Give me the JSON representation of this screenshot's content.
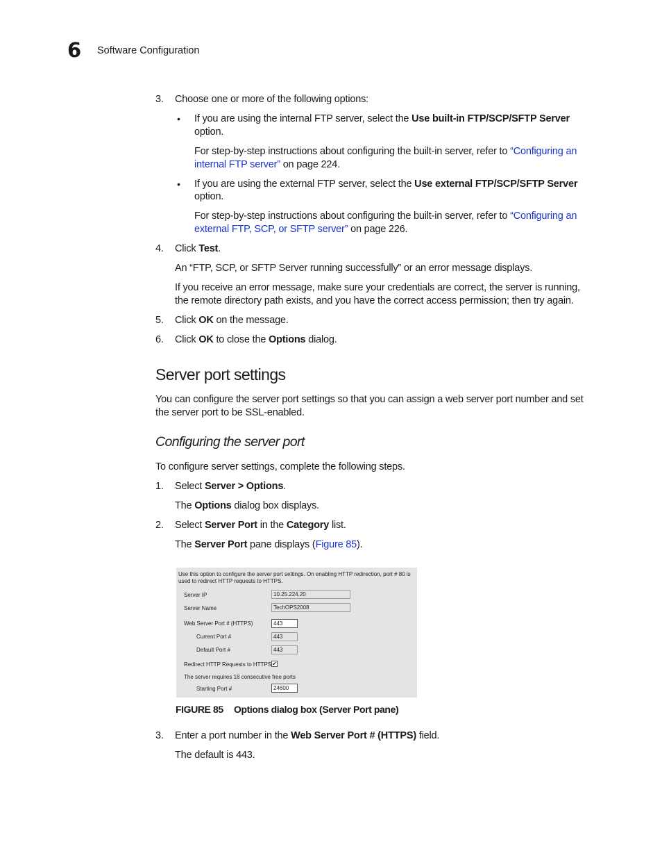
{
  "header": {
    "chapter_number": "6",
    "chapter_title": "Software Configuration"
  },
  "section1": {
    "step3": {
      "number": "3.",
      "text": "Choose one or more of the following options:",
      "bullets": [
        {
          "symbol": "•",
          "pre": "If you are using the internal FTP server, select the ",
          "bold": "Use built-in FTP/SCP/SFTP Server",
          "post_line2": "option.",
          "ref_pre": "For step-by-step instructions about configuring the built-in server, refer to ",
          "ref_link_line1": "“Configuring an",
          "ref_link_line2": "internal FTP server”",
          "ref_post": " on page 224."
        },
        {
          "symbol": "•",
          "pre": "If you are using the external FTP server, select the ",
          "bold": "Use external FTP/SCP/SFTP Server",
          "post_line2": "option.",
          "ref_pre": "For step-by-step instructions about configuring the built-in server, refer to ",
          "ref_link_line1": "“Configuring an",
          "ref_link_line2": "external FTP, SCP, or SFTP server”",
          "ref_post": " on page 226."
        }
      ]
    },
    "step4": {
      "number": "4.",
      "pre": "Click ",
      "bold": "Test",
      "post": ".",
      "result": "An “FTP, SCP, or SFTP Server running successfully” or an error message displays.",
      "note_line1": "If you receive an error message, make sure your credentials are correct, the server is running,",
      "note_line2": "the remote directory path exists, and you have the correct access permission; then try again."
    },
    "step5": {
      "number": "5.",
      "pre": "Click ",
      "bold": "OK",
      "post": " on the message."
    },
    "step6": {
      "number": "6.",
      "pre": "Click ",
      "bold": "OK",
      "mid": " to close the ",
      "bold2": "Options",
      "post": " dialog."
    }
  },
  "section2": {
    "heading": "Server port settings",
    "intro_line1": "You can configure the server port settings so that you can assign a web server port number and set",
    "intro_line2": "the server port to be SSL-enabled.",
    "subheading": "Configuring the server port",
    "lead": "To configure server settings, complete the following steps.",
    "step1": {
      "number": "1.",
      "pre": "Select ",
      "bold": "Server > Options",
      "post": ".",
      "result_pre": "The ",
      "result_bold": "Options",
      "result_post": " dialog box displays."
    },
    "step2": {
      "number": "2.",
      "pre": "Select ",
      "bold": "Server Port",
      "mid": " in the ",
      "bold2": "Category",
      "post": " list.",
      "result_pre": "The ",
      "result_bold": "Server Port",
      "result_mid": " pane displays (",
      "result_link": "Figure 85",
      "result_post": ")."
    },
    "step3": {
      "number": "3.",
      "pre": "Enter a port number in the ",
      "bold": "Web Server Port # (HTTPS)",
      "post": " field.",
      "result": "The default is 443."
    }
  },
  "figure": {
    "description_line1": "Use this option to configure the server port settings. On enabling HTTP redirection, port # 80 is",
    "description_line2": "used to redirect HTTP requests to HTTPS.",
    "server_ip_label": "Server IP",
    "server_ip_value": "10.25.224.20",
    "server_name_label": "Server Name",
    "server_name_value": "TechOPS2008",
    "web_port_label": "Web Server Port # (HTTPS)",
    "web_port_value": "443",
    "current_port_label": "Current Port #",
    "current_port_value": "443",
    "default_port_label": "Default Port #",
    "default_port_value": "443",
    "redirect_label": "Redirect HTTP Requests to HTTPS",
    "redirect_checked": true,
    "redirect_check_glyph": "✔",
    "free_ports_note": "The server requires 18 consecutive free ports",
    "starting_port_label": "Starting Port #",
    "starting_port_value": "24600",
    "caption_label": "FIGURE 85",
    "caption_text": "Options dialog box (Server Port pane)"
  }
}
